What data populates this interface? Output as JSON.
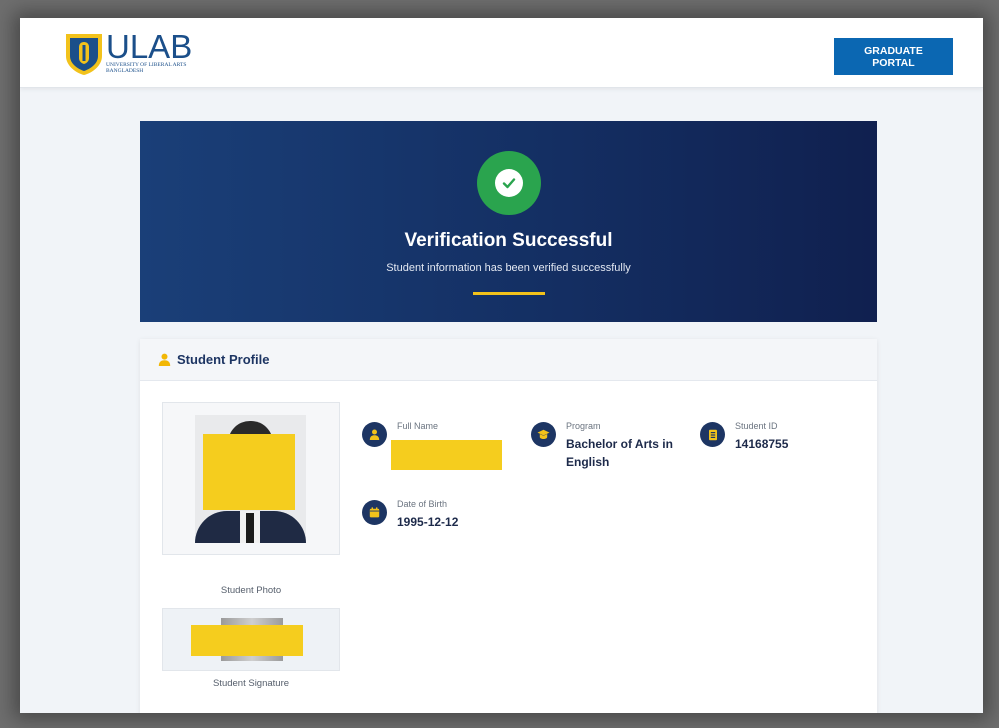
{
  "header": {
    "logo_text": "ULAB",
    "logo_subtext": "University of Liberal Arts Bangladesh",
    "portal_button": "GRADUATE PORTAL"
  },
  "hero": {
    "title": "Verification Successful",
    "subtitle": "Student information has been verified successfully"
  },
  "profile": {
    "title": "Student Profile",
    "photo_caption": "Student Photo",
    "signature_caption": "Student Signature",
    "fields": [
      {
        "label": "Full Name",
        "value": ""
      },
      {
        "label": "Program",
        "value": "Bachelor of Arts in English"
      },
      {
        "label": "Student ID",
        "value": "14168755"
      },
      {
        "label": "Date of Birth",
        "value": "1995-12-12"
      }
    ]
  },
  "colors": {
    "brand_blue": "#1b4f8a",
    "portal_button": "#0b67b2",
    "hero_navy": "#142f63",
    "success_green": "#2aa44e",
    "accent_gold": "#f2c21b",
    "redaction_yellow": "#f5cd1e"
  },
  "icons": {
    "success": "check-icon",
    "profile": "user-icon",
    "full_name": "user-icon",
    "program": "graduation-cap-icon",
    "student_id": "id-card-icon",
    "date_of_birth": "calendar-icon"
  }
}
